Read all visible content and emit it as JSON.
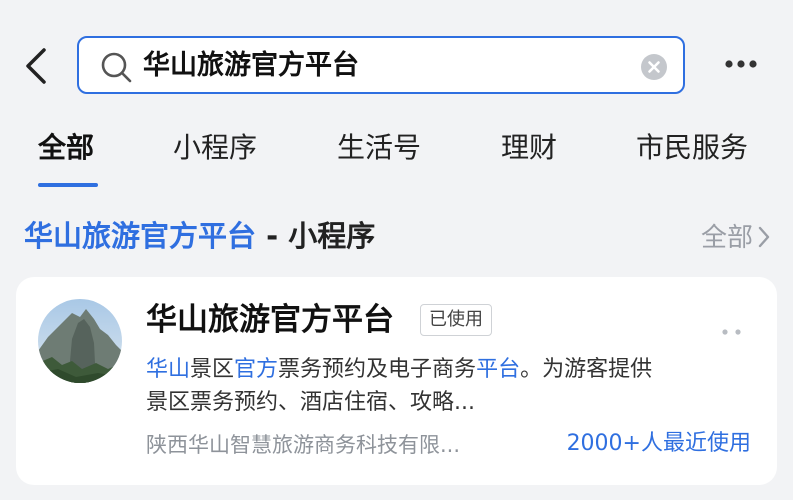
{
  "search": {
    "query": "华山旅游官方平台"
  },
  "tabs": [
    {
      "label": "全部",
      "active": true
    },
    {
      "label": "小程序",
      "active": false
    },
    {
      "label": "生活号",
      "active": false
    },
    {
      "label": "理财",
      "active": false
    },
    {
      "label": "市民服务",
      "active": false
    }
  ],
  "section": {
    "title_highlight": "华山旅游官方平台",
    "title_suffix": " - 小程序",
    "see_all": "全部"
  },
  "result": {
    "name": "华山旅游官方平台",
    "badge": "已使用",
    "description": {
      "line1": [
        {
          "text": "华山",
          "highlight": true
        },
        {
          "text": "景区",
          "highlight": false
        },
        {
          "text": "官方",
          "highlight": true
        },
        {
          "text": "票务预约及电子商务",
          "highlight": false
        },
        {
          "text": "平台",
          "highlight": true
        },
        {
          "text": "。为游客提供",
          "highlight": false
        }
      ],
      "line2": "景区票务预约、酒店住宿、攻略..."
    },
    "company": "陕西华山智慧旅游商务科技有限...",
    "usage": "2000+人最近使用"
  },
  "icons": {
    "back": "back-chevron-icon",
    "search": "search-icon",
    "clear": "clear-icon",
    "more": "more-icon",
    "see_all": "chevron-right-icon",
    "card_more": "more-icon"
  },
  "colors": {
    "accent": "#2f6fe0",
    "background": "#f2f3f5",
    "muted": "#9a9ea6"
  }
}
